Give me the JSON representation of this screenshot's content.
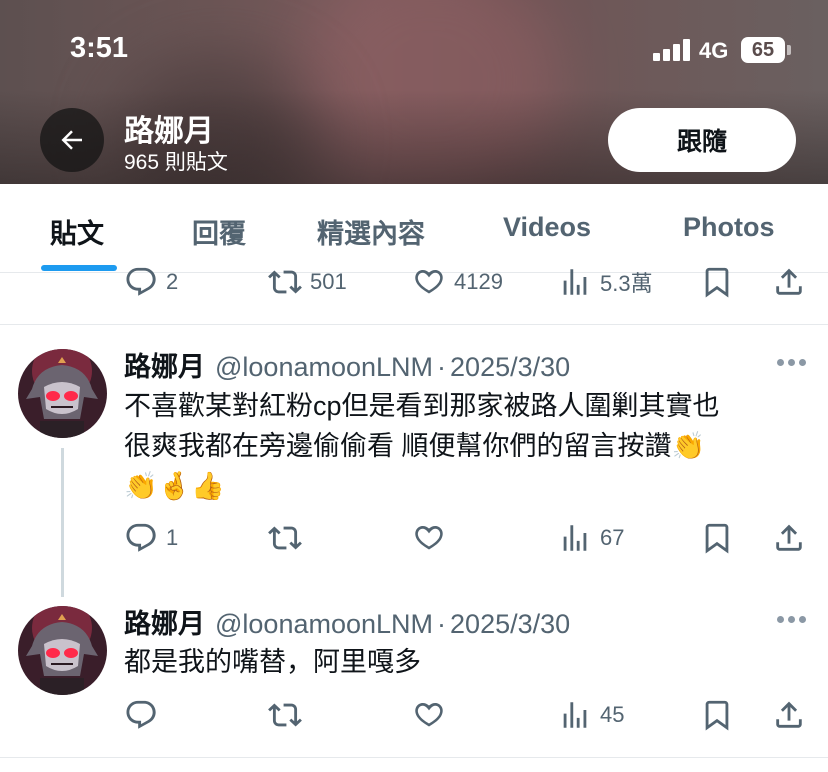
{
  "status_bar": {
    "time": "3:51",
    "network": "4G",
    "battery": "65"
  },
  "header": {
    "profile_name": "路娜月",
    "post_count": "965 則貼文",
    "follow_label": "跟隨"
  },
  "tabs": [
    {
      "label": "貼文",
      "active": true
    },
    {
      "label": "回覆",
      "active": false
    },
    {
      "label": "精選內容",
      "active": false
    },
    {
      "label": "Videos",
      "active": false
    },
    {
      "label": "Photos",
      "active": false
    }
  ],
  "prev_tweet_actions": {
    "replies": "2",
    "retweets": "501",
    "likes": "4129",
    "views": "5.3萬"
  },
  "tweets": [
    {
      "display_name": "路娜月",
      "handle": "@loonamoonLNM",
      "separator": "·",
      "date": "2025/3/30",
      "text_line1": "不喜歡某對紅粉cp但是看到那家被路人圍剿其實也",
      "text_line2": "很爽我都在旁邊偷偷看 順便幫你們的留言按讚👏",
      "text_line3": "👏🤞👍",
      "replies": "1",
      "views": "67"
    },
    {
      "display_name": "路娜月",
      "handle": "@loonamoonLNM",
      "separator": "·",
      "date": "2025/3/30",
      "text_line1": "都是我的嘴替，阿里嘎多",
      "views": "45"
    }
  ],
  "colors": {
    "accent": "#1d9bf0",
    "text_primary": "#0f1419",
    "text_secondary": "#536471",
    "border": "#e6e9ec"
  },
  "icons": [
    "back-arrow-icon",
    "reply-icon",
    "retweet-icon",
    "like-icon",
    "views-icon",
    "bookmark-icon",
    "share-icon",
    "more-icon",
    "signal-icon",
    "battery-icon"
  ]
}
